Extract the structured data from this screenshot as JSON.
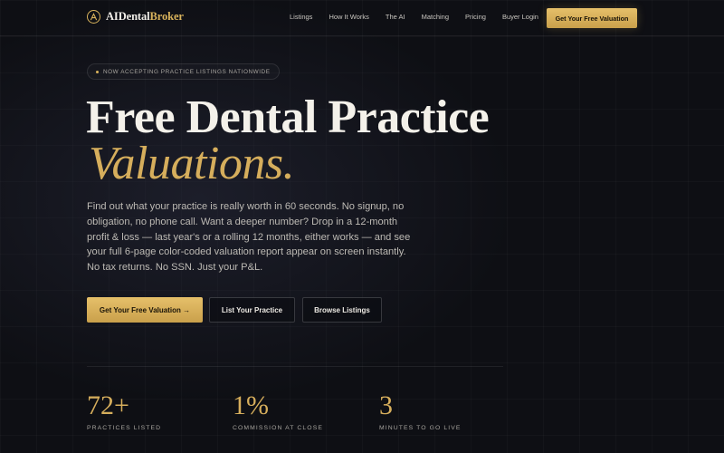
{
  "brand": {
    "name_part1": "AIDental",
    "name_part2": "Broker",
    "icon": "logo-icon",
    "accent_color": "#d9b35c"
  },
  "nav": {
    "links": [
      "Listings",
      "How It Works",
      "The AI",
      "Matching",
      "Pricing",
      "Buyer Login"
    ],
    "cta_label": "Get Your Free Valuation"
  },
  "hero": {
    "badge_text": "NOW ACCEPTING PRACTICE LISTINGS NATIONWIDE",
    "headline": "Free Dental Practice",
    "headline_accent": "Valuations.",
    "description": "Find out what your practice is really worth in 60 seconds. No signup, no obligation, no phone call. Want a deeper number? Drop in a 12-month profit & loss — last year's or a rolling 12 months, either works — and see your full 6-page color-coded valuation report appear on screen instantly. No tax returns. No SSN. Just your P&L.",
    "primary_button": "Get Your Free Valuation →",
    "secondary_button": "List Your Practice",
    "tertiary_button": "Browse Listings"
  },
  "stats": [
    {
      "value": "72+",
      "label": "PRACTICES LISTED"
    },
    {
      "value": "1%",
      "label": "COMMISSION AT CLOSE"
    },
    {
      "value": "3",
      "label": "MINUTES TO GO LIVE"
    }
  ]
}
